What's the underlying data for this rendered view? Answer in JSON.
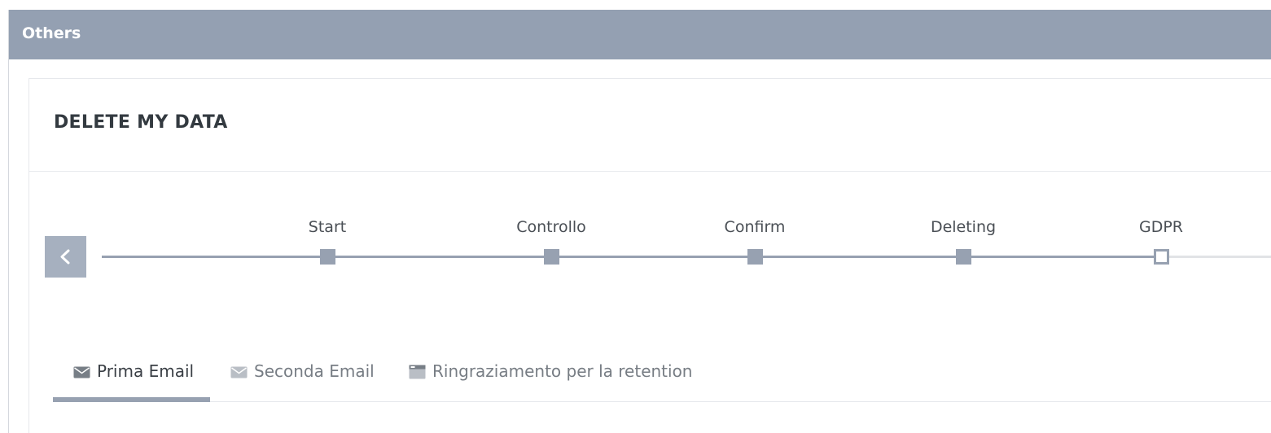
{
  "panel": {
    "title": "Others"
  },
  "card": {
    "title": "DELETE MY DATA"
  },
  "stepper": {
    "steps": [
      {
        "label": "Start",
        "state": "done"
      },
      {
        "label": "Controllo",
        "state": "done"
      },
      {
        "label": "Confirm",
        "state": "done"
      },
      {
        "label": "Deleting",
        "state": "done"
      },
      {
        "label": "GDPR",
        "state": "current"
      }
    ],
    "prev_icon": "chevron-left-icon"
  },
  "tabs": [
    {
      "label": "Prima Email",
      "icon": "envelope-icon",
      "active": true
    },
    {
      "label": "Seconda Email",
      "icon": "envelope-icon",
      "active": false
    },
    {
      "label": "Ringraziamento per la retention",
      "icon": "browser-window-icon",
      "active": false
    }
  ],
  "colors": {
    "header_bg": "#94a0b2",
    "accent": "#97a1b1",
    "prev_button_bg": "#a6b0bf"
  }
}
